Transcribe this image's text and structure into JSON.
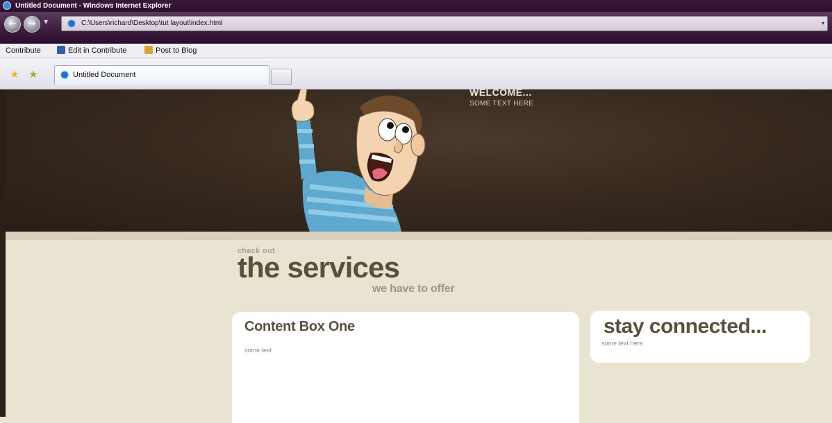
{
  "window": {
    "title": "Untitled Document - Windows Internet Explorer"
  },
  "browser": {
    "address": "C:\\Users\\richard\\Desktop\\tut layout\\index.html",
    "command_bar": {
      "contribute": "Contribute",
      "edit_in_contribute": "Edit in Contribute",
      "post_to_blog": "Post to Blog"
    },
    "tabs": [
      {
        "label": "Untitled Document"
      }
    ]
  },
  "page": {
    "banner": {
      "heading": "WELCOME...",
      "subtext": "SOME TEXT HERE"
    },
    "services": {
      "kicker": "check out",
      "title": "the services",
      "tagline": "we have to offer"
    },
    "content_box_one": {
      "title": "Content Box One",
      "text": "some text"
    },
    "stay_connected": {
      "title": "stay connected...",
      "text": "some text here"
    }
  },
  "colors": {
    "title_bar": "#2b0f2d",
    "banner": "#382a1f",
    "page_bg": "#e9e3d1",
    "heading_brown": "#5a513d"
  }
}
